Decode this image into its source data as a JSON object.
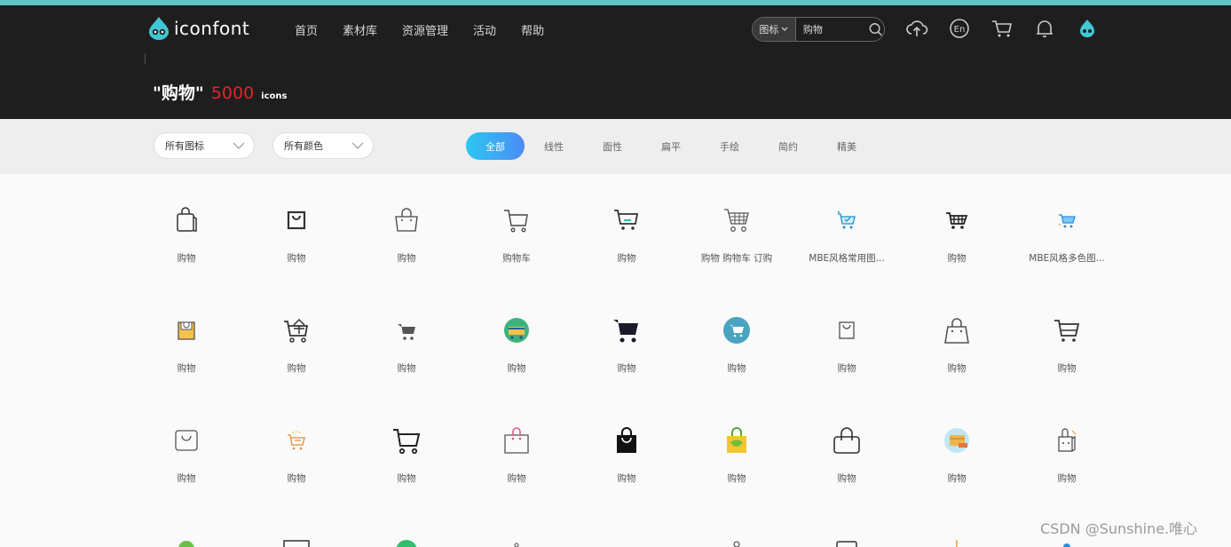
{
  "header": {
    "logo_text": "iconfont",
    "nav": [
      "首页",
      "素材库",
      "资源管理",
      "活动",
      "帮助"
    ],
    "search": {
      "type_label": "图标",
      "value": "购物"
    },
    "query_display": "\"购物\"",
    "count": "5000",
    "count_unit": "icons"
  },
  "filters": {
    "icon_select": "所有图标",
    "color_select": "所有颜色",
    "tabs": [
      "全部",
      "线性",
      "面性",
      "扁平",
      "手绘",
      "简约",
      "精美"
    ],
    "active_tab": "全部"
  },
  "icons": [
    [
      "购物",
      "购物",
      "购物",
      "购物车",
      "购物",
      "购物 购物车 订购",
      "MBE风格常用图...",
      "购物",
      "MBE风格多色图..."
    ],
    [
      "购物",
      "购物",
      "购物",
      "购物",
      "购物",
      "购物",
      "购物",
      "购物",
      "购物"
    ],
    [
      "购物",
      "购物",
      "购物",
      "购物",
      "购物",
      "购物",
      "购物",
      "购物",
      "购物"
    ]
  ],
  "watermark": "CSDN @Sunshine.唯心",
  "colors": {
    "accent_start": "#2bc7ef",
    "accent_end": "#4c8cf6",
    "count_red": "#e5222b",
    "header_bg": "#1e1e1e"
  }
}
